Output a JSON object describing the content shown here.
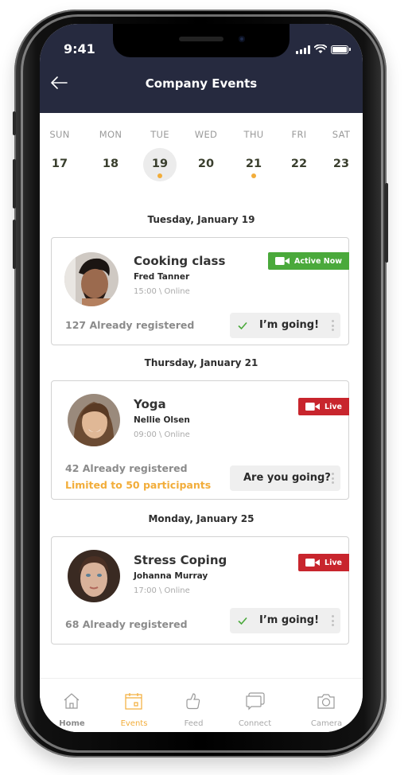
{
  "status_bar": {
    "time": "9:41"
  },
  "header": {
    "title": "Company Events",
    "back_icon": "arrow-left-icon"
  },
  "week": {
    "days": [
      {
        "name": "SUN",
        "num": "17",
        "selected": false,
        "has_event": false
      },
      {
        "name": "MON",
        "num": "18",
        "selected": false,
        "has_event": false
      },
      {
        "name": "TUE",
        "num": "19",
        "selected": true,
        "has_event": true
      },
      {
        "name": "WED",
        "num": "20",
        "selected": false,
        "has_event": false
      },
      {
        "name": "THU",
        "num": "21",
        "selected": false,
        "has_event": true
      },
      {
        "name": "FRI",
        "num": "22",
        "selected": false,
        "has_event": false
      },
      {
        "name": "SAT",
        "num": "23",
        "selected": false,
        "has_event": false
      }
    ]
  },
  "sections": [
    {
      "date": "Tuesday, January 19",
      "event": {
        "title": "Cooking class",
        "host": "Fred Tanner",
        "time": "15:00 \\ Online",
        "badge": {
          "label": "Active Now",
          "color": "#4aa93b"
        },
        "registered": "127 Already registered",
        "rsvp": {
          "label": "I’m going!",
          "checked": true
        }
      }
    },
    {
      "date": "Thursday, January 21",
      "event": {
        "title": "Yoga",
        "host": "Nellie Olsen",
        "time": "09:00 \\ Online",
        "badge": {
          "label": "Live",
          "color": "#c8252d"
        },
        "registered": "42 Already registered",
        "limit": "Limited to 50 participants",
        "rsvp": {
          "label": "Are you going?",
          "checked": false
        }
      }
    },
    {
      "date": "Monday, January 25",
      "event": {
        "title": "Stress Coping",
        "host": "Johanna Murray",
        "time": "17:00 \\ Online",
        "badge": {
          "label": "Live",
          "color": "#c8252d"
        },
        "registered": "68 Already registered",
        "rsvp": {
          "label": "I’m going!",
          "checked": true
        }
      }
    }
  ],
  "tabbar": {
    "items": [
      {
        "label": "Home",
        "icon": "home-icon",
        "active": false
      },
      {
        "label": "Events",
        "icon": "calendar-icon",
        "active": true
      },
      {
        "label": "Feed",
        "icon": "thumbs-up-icon",
        "active": false
      },
      {
        "label": "Connect",
        "icon": "chat-icon",
        "active": false
      },
      {
        "label": "Camera",
        "icon": "camera-icon",
        "active": false
      }
    ]
  },
  "colors": {
    "header_bg": "#262a3f",
    "accent": "#f2ad3a",
    "active_badge": "#4aa93b",
    "live_badge": "#c8252d",
    "check": "#4aa93b"
  }
}
